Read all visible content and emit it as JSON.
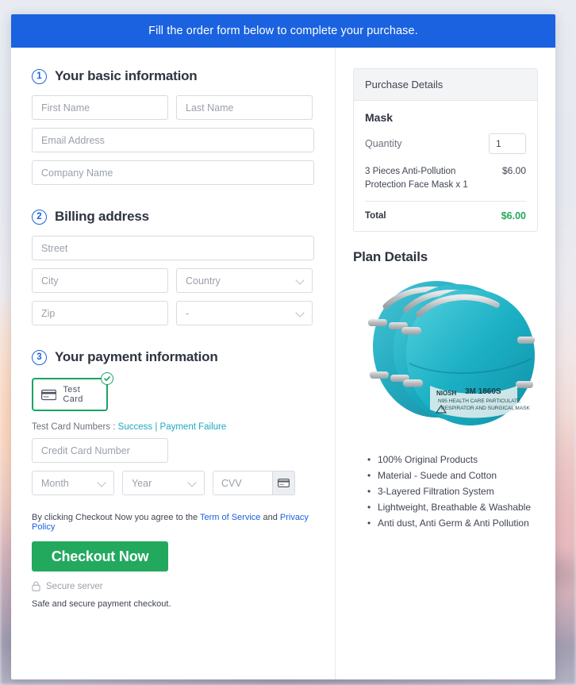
{
  "banner": {
    "text": "Fill the order form below to complete your purchase."
  },
  "sections": {
    "basic": {
      "step": "1",
      "title": "Your basic information",
      "fields": {
        "first_name": "First Name",
        "last_name": "Last Name",
        "email": "Email Address",
        "company": "Company Name"
      }
    },
    "billing": {
      "step": "2",
      "title": "Billing address",
      "fields": {
        "street": "Street",
        "city": "City",
        "country": "Country",
        "zip": "Zip",
        "state": "-"
      }
    },
    "payment": {
      "step": "3",
      "title": "Your payment information",
      "test_card_label": "Test Card",
      "test_numbers_prefix": "Test Card Numbers :",
      "test_numbers_success": "Success",
      "test_numbers_separator": "|",
      "test_numbers_failure": "Payment Failure",
      "card_number": "Credit Card Number",
      "month": "Month",
      "year": "Year",
      "cvv": "CVV",
      "terms_prefix": "By clicking Checkout Now you agree to the",
      "terms_link": "Term of Service",
      "terms_and": "and",
      "privacy_link": "Privacy Policy",
      "checkout_label": "Checkout Now",
      "secure_server": "Secure server",
      "safe_note": "Safe and secure payment checkout."
    }
  },
  "purchase": {
    "header": "Purchase Details",
    "product_name": "Mask",
    "quantity_label": "Quantity",
    "quantity_value": "1",
    "line_item_desc": "3 Pieces Anti-Pollution Protection Face Mask x 1",
    "line_item_price": "$6.00",
    "total_label": "Total",
    "total_price": "$6.00"
  },
  "plan": {
    "title": "Plan Details",
    "features": [
      "100% Original Products",
      "Material - Suede and Cotton",
      "3-Layered Filtration System",
      "Lightweight, Breathable & Washable",
      "Anti dust, Anti Germ & Anti Pollution"
    ]
  },
  "colors": {
    "banner_blue": "#1a62e0",
    "accent_green": "#22a95e",
    "card_border_green": "#19a463",
    "link_blue": "#1a62e0",
    "link_teal": "#1fa9bf",
    "mask_teal": "#17a2b8"
  }
}
